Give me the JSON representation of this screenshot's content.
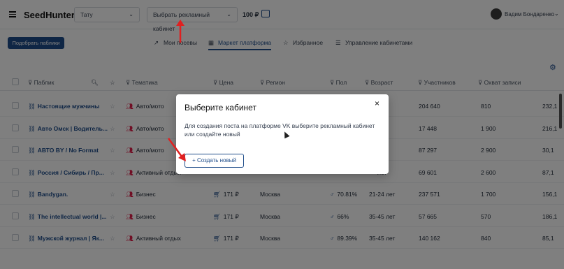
{
  "header": {
    "logo": "SeedHunter",
    "project_select": "Тату",
    "cabinet_select": "Выбрать рекламный кабинет",
    "balance": "100 ₽",
    "user_name": "Вадим Бондаренко"
  },
  "toolbar": {
    "pick_button": "Подобрать паблики",
    "tabs": [
      {
        "label": "Мои посевы",
        "icon": "chart-line-icon"
      },
      {
        "label": "Маркет платформа",
        "icon": "grid-icon"
      },
      {
        "label": "Избранное",
        "icon": "star-icon"
      },
      {
        "label": "Управление кабинетами",
        "icon": "list-icon"
      }
    ]
  },
  "table": {
    "columns": [
      "Паблик",
      "Тематика",
      "Цена",
      "Регион",
      "Пол",
      "Возраст",
      "Участников",
      "Охват записи"
    ],
    "rows": [
      {
        "name": "Настоящие мужчины",
        "topic": "Авто/мото",
        "price": "",
        "region": "",
        "gender": "",
        "age": "лет",
        "members": "204 640",
        "reach": "810",
        "extra": "232,1"
      },
      {
        "name": "Авто Омск | Водитель...",
        "topic": "Авто/мото",
        "price": "",
        "region": "",
        "gender": "",
        "age": "лет",
        "members": "17 448",
        "reach": "1 900",
        "extra": "216,1"
      },
      {
        "name": "АВТО BY / No Format",
        "topic": "Авто/мото",
        "price": "",
        "region": "",
        "gender": "",
        "age": "лет",
        "members": "87 297",
        "reach": "2 900",
        "extra": "30,1"
      },
      {
        "name": "Россия / Сибирь / Пр...",
        "topic": "Активный отдых",
        "price": "",
        "region": "",
        "gender": "",
        "age": "лет",
        "members": "69 601",
        "reach": "2 600",
        "extra": "87,1"
      },
      {
        "name": "Bandygan.",
        "topic": "Бизнес",
        "price": "171 ₽",
        "region": "Москва",
        "gender": "70.81%",
        "age": "21-24 лет",
        "members": "237 571",
        "reach": "1 700",
        "extra": "156,1"
      },
      {
        "name": "The intellectual world |...",
        "topic": "Бизнес",
        "price": "171 ₽",
        "region": "Москва",
        "gender": "66%",
        "age": "35-45 лет",
        "members": "57 665",
        "reach": "570",
        "extra": "186,1"
      },
      {
        "name": "Мужской журнал | Як...",
        "topic": "Активный отдых",
        "price": "171 ₽",
        "region": "Москва",
        "gender": "89.39%",
        "age": "35-45 лет",
        "members": "140 162",
        "reach": "840",
        "extra": "85,1"
      }
    ]
  },
  "modal": {
    "title": "Выберите кабинет",
    "text": "Для создания поста на платформе VK выберите рекламный кабинет или создайте новый",
    "create_button": "+ Создать новый",
    "close_icon": "×"
  },
  "colors": {
    "accent": "#1f4d8a",
    "annotation_arrow": "#e02020"
  }
}
